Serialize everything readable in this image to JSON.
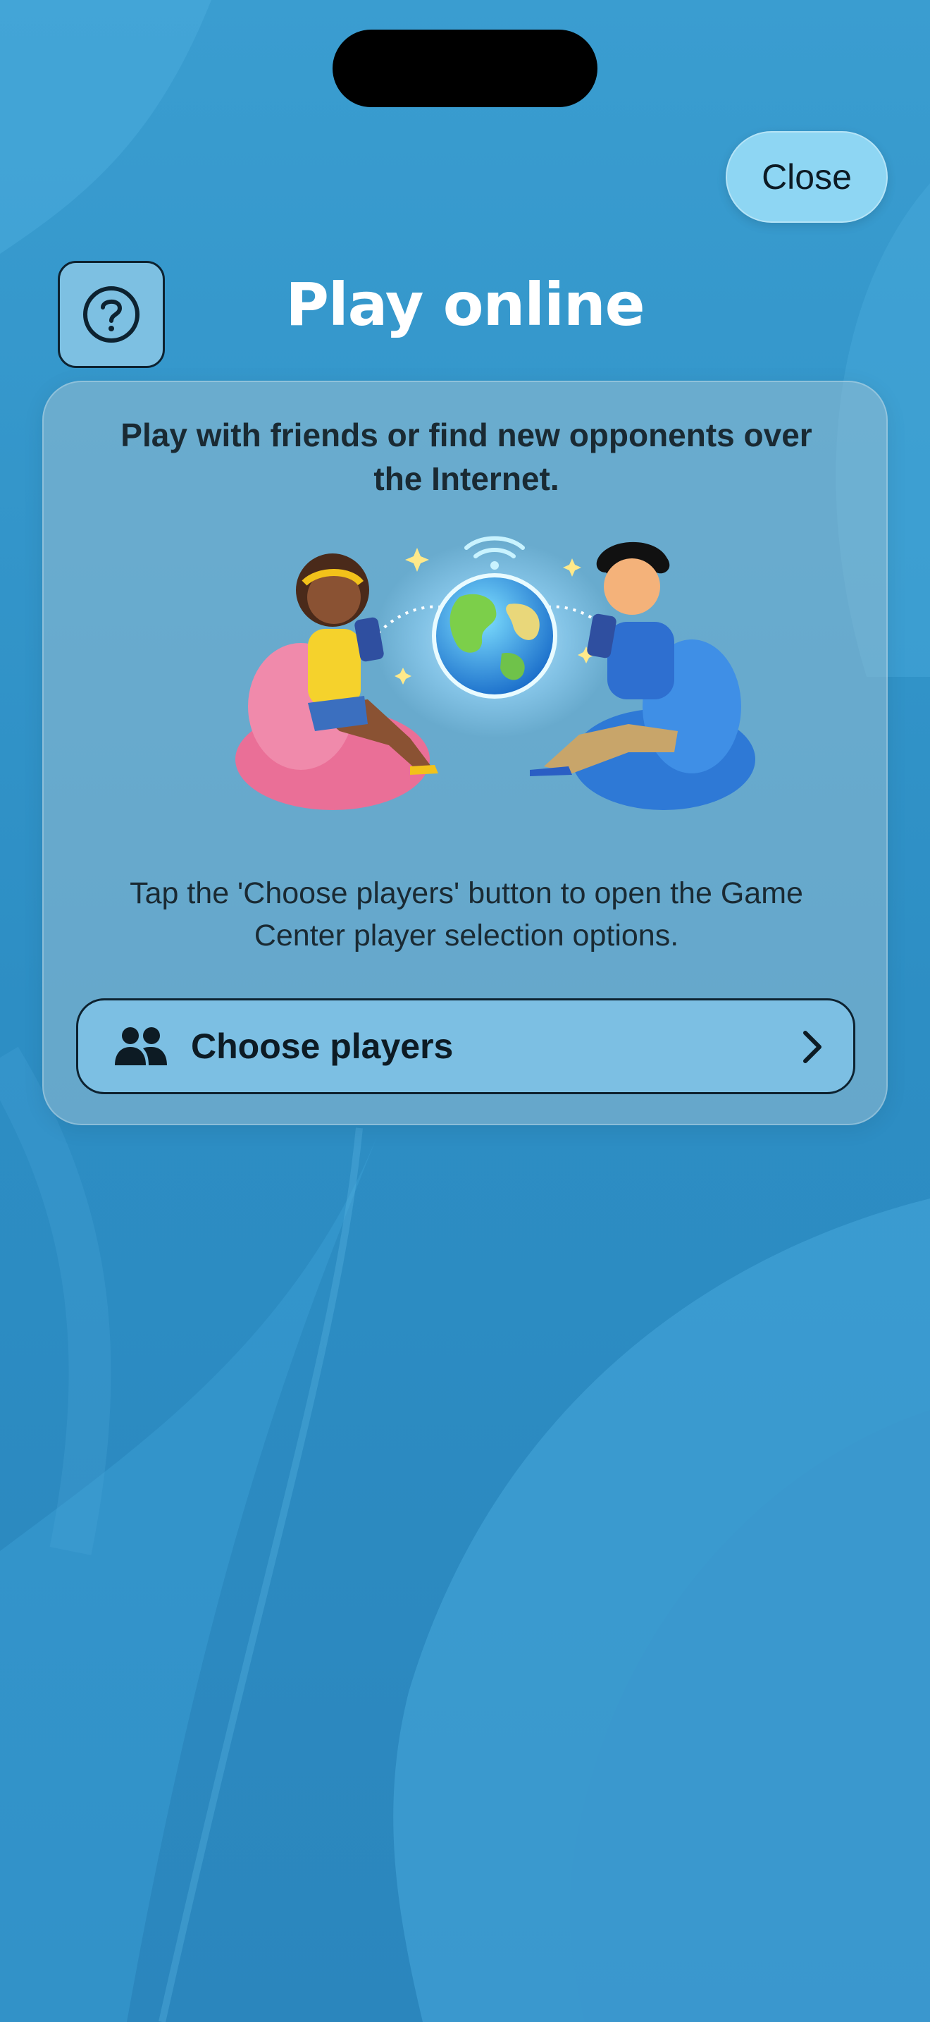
{
  "header": {
    "close_label": "Close",
    "title": "Play online"
  },
  "card": {
    "intro": "Play with friends or find new opponents over the Internet.",
    "description": "Tap the 'Choose players' button to open the Game Center player selection options.",
    "choose_label": "Choose players"
  },
  "icons": {
    "help": "question-mark-circle-icon",
    "people": "two-people-icon",
    "chevron": "chevron-right-icon"
  },
  "colors": {
    "background": "#2f8fc4",
    "close_button": "#8ed6f3",
    "choose_button": "#7cbfe3",
    "title": "#ffffff"
  }
}
